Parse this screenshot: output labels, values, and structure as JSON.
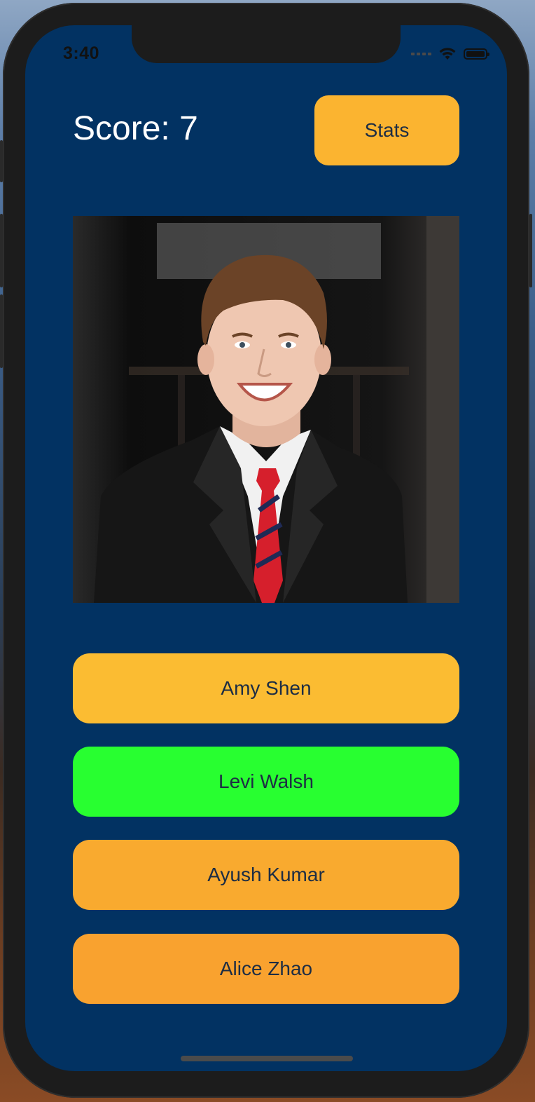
{
  "status_bar": {
    "time": "3:40"
  },
  "header": {
    "score_text": "Score: 7",
    "stats_label": "Stats",
    "stats_color": "#fbb430"
  },
  "photo": {
    "icon": "person-portrait"
  },
  "answers": [
    {
      "label": "Amy Shen",
      "color": "#fbbc32"
    },
    {
      "label": "Levi Walsh",
      "color": "#28ff30"
    },
    {
      "label": "Ayush Kumar",
      "color": "#f9aa2f"
    },
    {
      "label": "Alice Zhao",
      "color": "#f9a22f"
    }
  ],
  "colors": {
    "background": "#023262",
    "text_dark": "#1d2d44",
    "text_light": "#ffffff"
  }
}
